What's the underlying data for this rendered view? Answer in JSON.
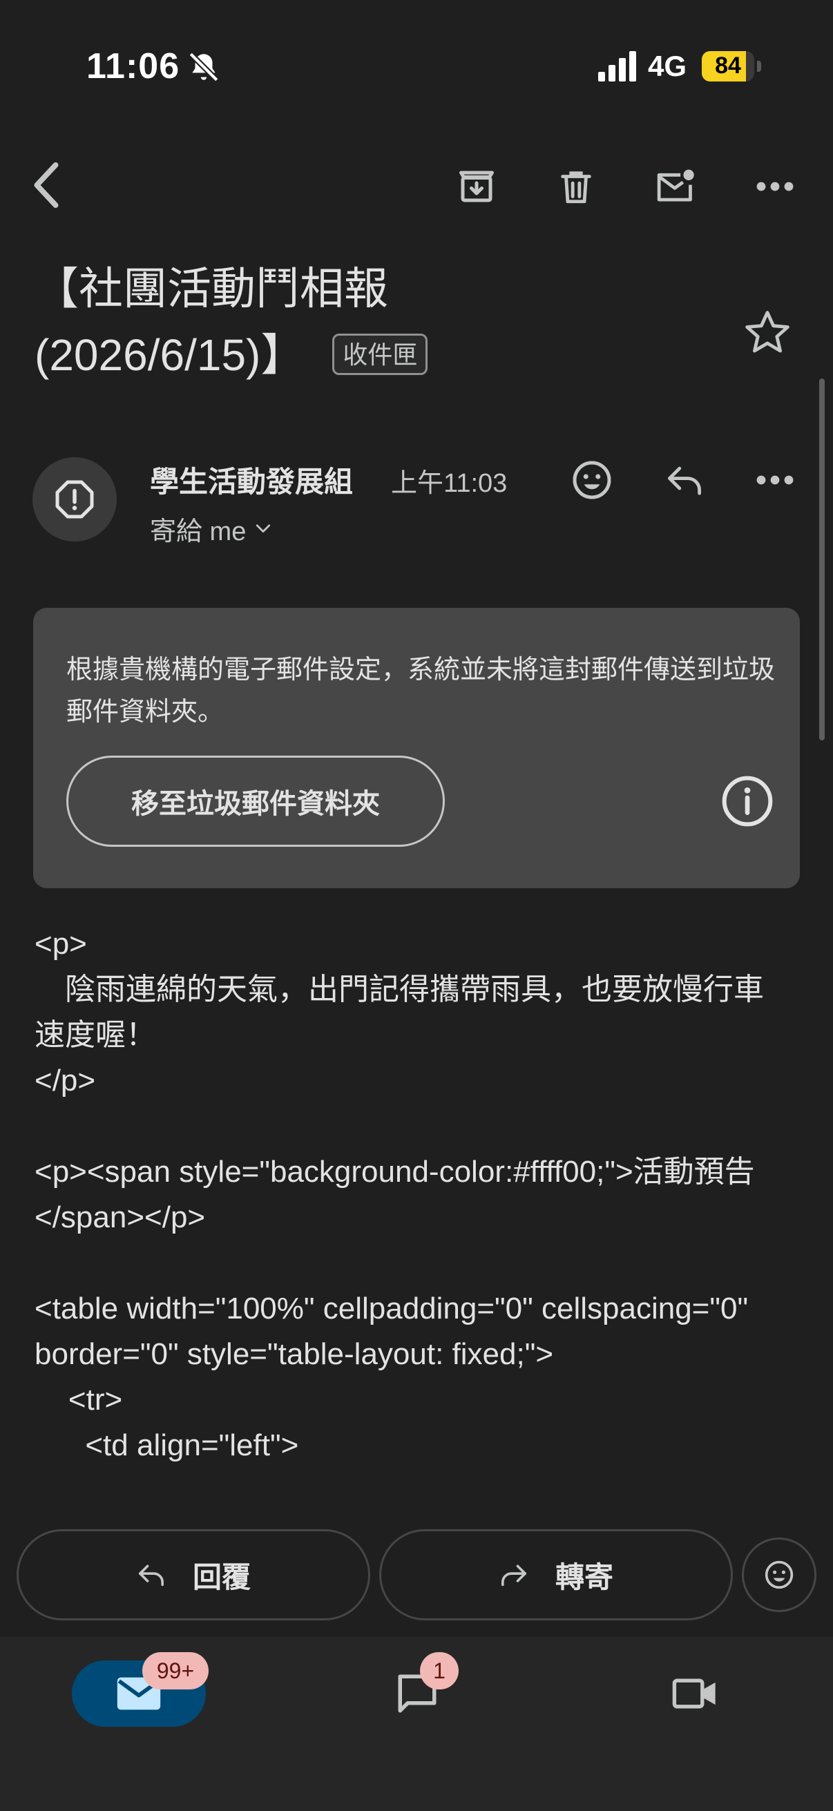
{
  "status_bar": {
    "time": "11:06",
    "network": "4G",
    "battery": "84",
    "battery_level_percent": 84
  },
  "toolbar": {
    "icons": [
      "back-arrow-icon",
      "archive-icon",
      "delete-icon",
      "mark-unread-icon",
      "more-icon"
    ]
  },
  "email": {
    "subject_line1": "【社團活動鬥相報",
    "subject_line2": "(2026/6/15)】",
    "label": "收件匣",
    "sender_name": "學生活動發展組",
    "time": "上午11:03",
    "recipient": "寄給 me"
  },
  "notice": {
    "text": "根據貴機構的電子郵件設定，系統並未將這封郵件傳送到垃圾郵件資料夾。",
    "button": "移至垃圾郵件資料夾"
  },
  "body": {
    "lines": [
      "<p>",
      "　陰雨連綿的天氣，出門記得攜帶雨具，也要放慢行車速度喔！",
      "</p>",
      "",
      "<p><span style=\"background-color:#ffff00;\">活動預告</span></p>",
      "",
      "<table width=\"100%\" cellpadding=\"0\" cellspacing=\"0\" border=\"0\" style=\"table-layout: fixed;\">",
      "    <tr>",
      "      <td align=\"left\">"
    ]
  },
  "actions": {
    "reply": "回覆",
    "forward": "轉寄"
  },
  "bottom_nav": {
    "mail_badge": "99+",
    "chat_badge": "1"
  },
  "colors": {
    "background": "#1f1f1f",
    "notice_bg": "#474747",
    "mail_pill": "#004a77",
    "badge": "#f2b8b5",
    "battery": "#f7d21f"
  }
}
